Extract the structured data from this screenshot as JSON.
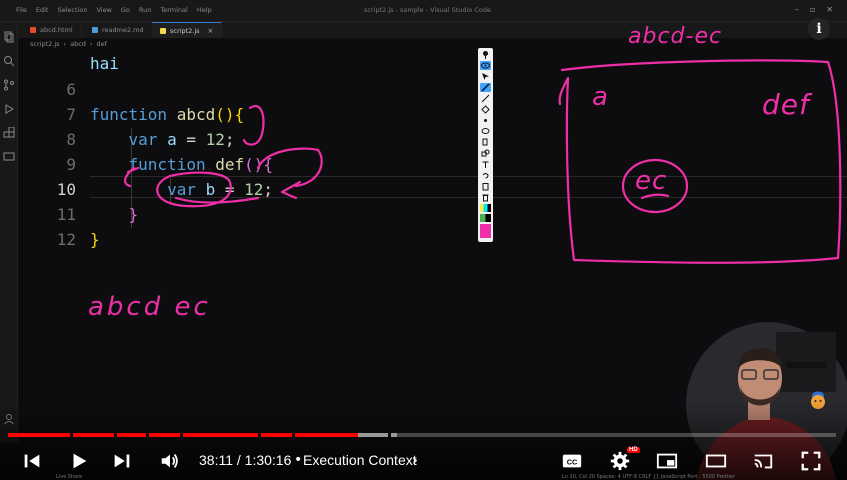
{
  "vscode": {
    "menu": [
      "File",
      "Edit",
      "Selection",
      "View",
      "Go",
      "Run",
      "Terminal",
      "Help"
    ],
    "window_title": "script2.js - sample - Visual Studio Code",
    "tabs": [
      {
        "label": "abcd.html",
        "color": "#e44d26"
      },
      {
        "label": "readme2.md",
        "color": "#4a9eda"
      },
      {
        "label": "script2.js",
        "color": "#f0db4f"
      }
    ],
    "breadcrumb": [
      "script2.js",
      "abcd",
      "def"
    ]
  },
  "code": {
    "hai_line": "hai",
    "lines": [
      {
        "n": "6"
      },
      {
        "n": "7",
        "parts": [
          [
            "kw",
            "function "
          ],
          [
            "fn",
            "abcd"
          ],
          [
            "pn",
            "()"
          ],
          [
            "pn",
            "{"
          ]
        ]
      },
      {
        "n": "8",
        "parts": [
          [
            "kw",
            "    var "
          ],
          [
            "vr",
            "a"
          ],
          [
            "txt",
            " = "
          ],
          [
            "num",
            "12"
          ],
          [
            "txt",
            ";"
          ]
        ]
      },
      {
        "n": "9",
        "parts": [
          [
            "kw",
            "    function "
          ],
          [
            "fn",
            "def"
          ],
          [
            "pn",
            "()"
          ],
          [
            "pn",
            "{"
          ]
        ]
      },
      {
        "n": "10",
        "parts": [
          [
            "kw",
            "        var "
          ],
          [
            "vr",
            "b"
          ],
          [
            "txt",
            " = "
          ],
          [
            "num",
            "12"
          ],
          [
            "txt",
            ";"
          ]
        ]
      },
      {
        "n": "11",
        "parts": [
          [
            "pn",
            "    }"
          ]
        ]
      },
      {
        "n": "12",
        "parts": [
          [
            "pn",
            "}"
          ]
        ]
      }
    ]
  },
  "annotations": {
    "top_note": "abcd-ec",
    "box_a": "a",
    "box_def": "def",
    "box_ec": "ec",
    "bottom_note": "abcd ec",
    "ink_color": "#ee2fa8"
  },
  "player": {
    "current_time": "38:11",
    "duration": "1:30:16",
    "time_separator": "/",
    "chapter_separator": "•",
    "chapter": "Execution Context",
    "played_fraction": 0.423,
    "buffered_fraction": 0.47,
    "hd_badge": "HD"
  },
  "statusbar": {
    "left": "Live Share",
    "right": "Ln 10, Col 20   Spaces: 4   UTF-8   CRLF   {} JavaScript   Port : 5500   Prettier"
  },
  "info_label": "i"
}
